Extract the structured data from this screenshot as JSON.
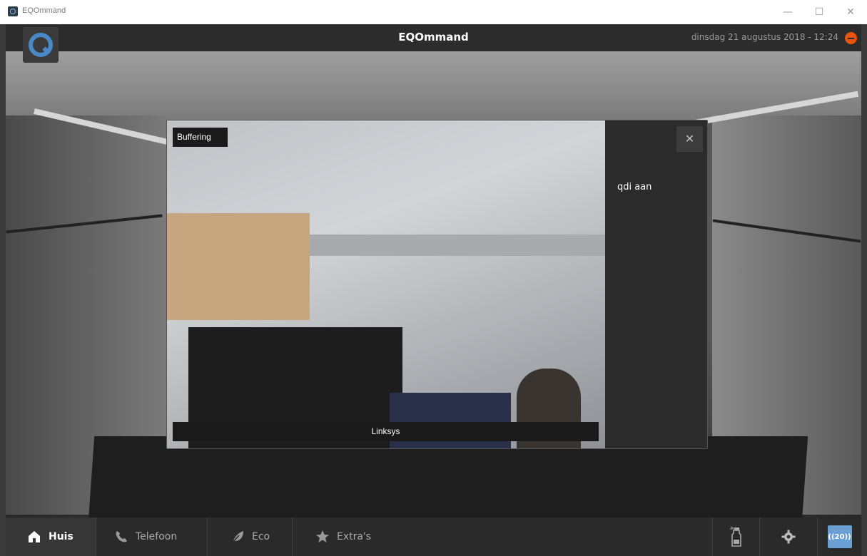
{
  "window": {
    "title": "EQOmmand",
    "controls": {
      "minimize": "—",
      "maximize": "☐",
      "close": "✕"
    }
  },
  "header": {
    "app_name": "EQOmmand",
    "datetime": "dinsdag 21 augustus 2018 - 12:24",
    "logo_icon": "eqommand-logo"
  },
  "modal": {
    "status": "Buffering",
    "camera_name": "Linksys",
    "side_label": "qdi aan",
    "close_glyph": "✕"
  },
  "nav": {
    "tabs": [
      {
        "label": "Huis",
        "icon": "home-icon",
        "active": true
      },
      {
        "label": "Telefoon",
        "icon": "phone-icon",
        "active": false
      },
      {
        "label": "Eco",
        "icon": "leaf-icon",
        "active": false
      },
      {
        "label": "Extra's",
        "icon": "star-icon",
        "active": false
      }
    ],
    "right": {
      "spray_icon": "spray-bottle-icon",
      "settings_icon": "gear-icon",
      "badge": "((20))"
    }
  },
  "colors": {
    "accent": "#4a88c7",
    "alert": "#e8530e",
    "badge": "#6b9fd4",
    "bar": "#2a2a2a"
  }
}
